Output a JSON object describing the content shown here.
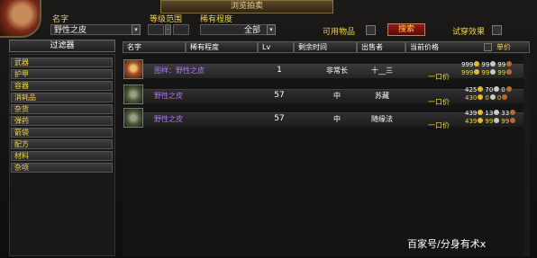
{
  "window": {
    "title": "浏览拍卖"
  },
  "filters_bar": {
    "name_label": "名字",
    "name_value": "野性之皮",
    "level_label": "等级范围",
    "rarity_label": "稀有程度",
    "rarity_value": "全部",
    "usable_label": "可用物品",
    "search_button": "搜索",
    "preview_label": "试穿效果"
  },
  "filter_panel": {
    "header": "过滤器",
    "categories": [
      "武器",
      "护甲",
      "容器",
      "消耗品",
      "杂货",
      "弹药",
      "箭袋",
      "配方",
      "材料",
      "杂项"
    ]
  },
  "columns": {
    "name": "名字",
    "rarity": "稀有程度",
    "lv": "Lv",
    "time_left": "剩余时间",
    "seller": "出售者",
    "price": "当前价格",
    "unit_price": "单价"
  },
  "bid_label": "一口价",
  "rows": [
    {
      "name": "图样：野性之皮",
      "lv": "1",
      "time": "非常长",
      "seller": "十__三",
      "cur": [
        "999",
        "99",
        "99"
      ],
      "buy": [
        "999",
        "99",
        "99"
      ]
    },
    {
      "name": "野性之皮",
      "lv": "57",
      "time": "中",
      "seller": "苏藏",
      "cur": [
        "425",
        "70",
        "0"
      ],
      "buy": [
        "430",
        "0",
        "0"
      ]
    },
    {
      "name": "野性之皮",
      "lv": "57",
      "time": "中",
      "seller": "随缘法",
      "cur": [
        "439",
        "13",
        "33"
      ],
      "buy": [
        "439",
        "99",
        "99"
      ]
    }
  ],
  "watermark": "百家号/分身有术x",
  "colors": {
    "gold_text": "#f0d34a",
    "epic_purple": "#b47ae6",
    "search_red": "#9a1a10"
  }
}
